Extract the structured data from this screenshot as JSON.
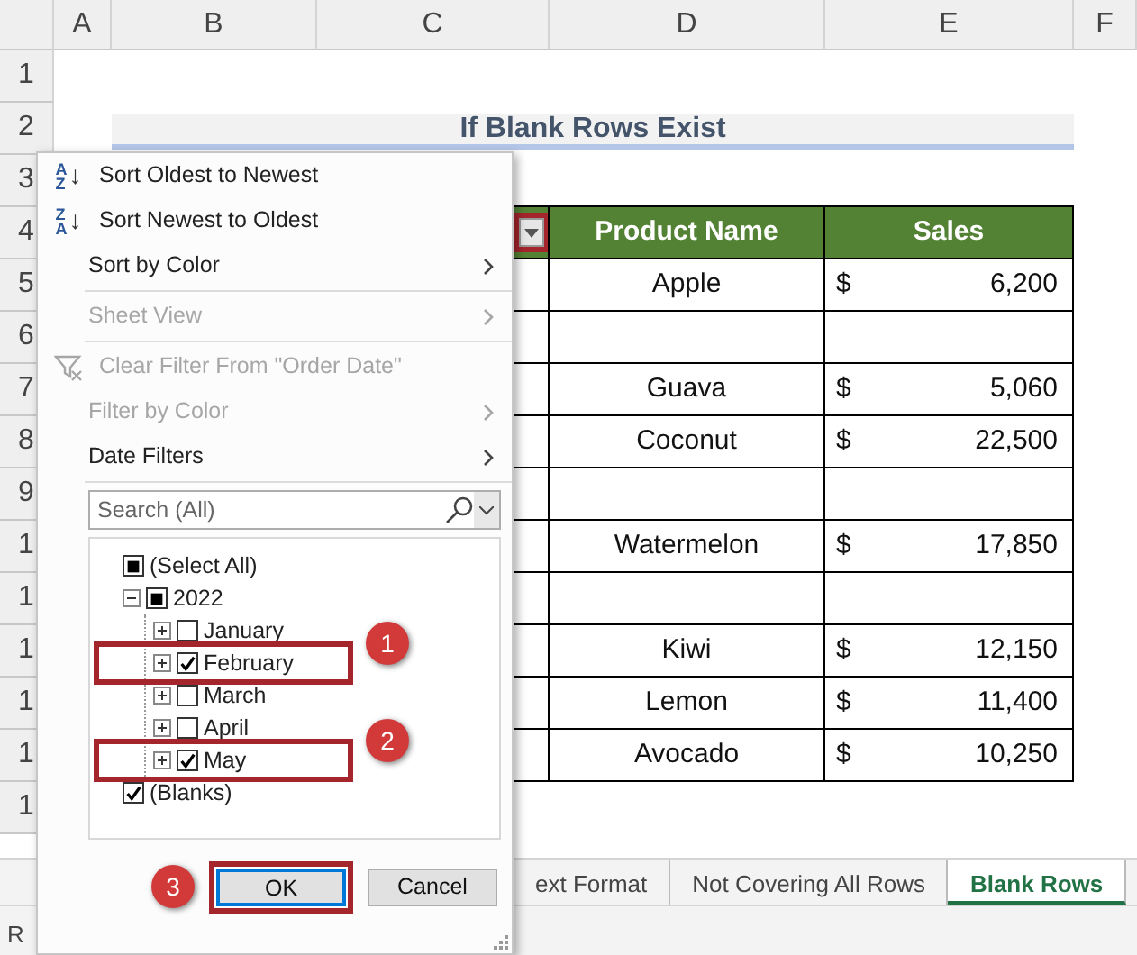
{
  "columns": [
    "A",
    "B",
    "C",
    "D",
    "E",
    "F"
  ],
  "rows": [
    "1",
    "2",
    "3",
    "4",
    "5",
    "6",
    "7",
    "8",
    "9",
    "1",
    "1",
    "1",
    "1",
    "1",
    "1"
  ],
  "title": "If Blank Rows Exist",
  "table": {
    "filter_button": {
      "highlighted": true
    },
    "columns": [
      "Product Name",
      "Sales"
    ],
    "rows": [
      {
        "product": "Apple",
        "currency": "$",
        "sales": "6,200"
      },
      {},
      {
        "product": "Guava",
        "currency": "$",
        "sales": "5,060"
      },
      {
        "product": "Coconut",
        "currency": "$",
        "sales": "22,500"
      },
      {},
      {
        "product": "Watermelon",
        "currency": "$",
        "sales": "17,850"
      },
      {},
      {
        "product": "Kiwi",
        "currency": "$",
        "sales": "12,150"
      },
      {
        "product": "Lemon",
        "currency": "$",
        "sales": "11,400"
      },
      {
        "product": "Avocado",
        "currency": "$",
        "sales": "10,250"
      }
    ]
  },
  "sheet_tabs": [
    {
      "label": "ext Format",
      "selected": false
    },
    {
      "label": "Not Covering All Rows",
      "selected": false
    },
    {
      "label": "Blank Rows",
      "selected": true
    }
  ],
  "status_bar": "R",
  "filter_menu": {
    "items": [
      {
        "kind": "sort",
        "label": "Sort Oldest to Newest",
        "icon": {
          "top": "A",
          "bottom": "Z",
          "arrow": "↓"
        },
        "disabled": false,
        "submenu": false
      },
      {
        "kind": "sort",
        "label": "Sort Newest to Oldest",
        "icon": {
          "top": "Z",
          "bottom": "A",
          "arrow": "↓"
        },
        "disabled": false,
        "submenu": false
      },
      {
        "kind": "item",
        "label": "Sort by Color",
        "disabled": false,
        "submenu": true
      },
      {
        "kind": "separator"
      },
      {
        "kind": "item",
        "label": "Sheet View",
        "disabled": true,
        "submenu": true
      },
      {
        "kind": "separator"
      },
      {
        "kind": "clear",
        "label": "Clear Filter From \"Order Date\"",
        "disabled": true,
        "submenu": false
      },
      {
        "kind": "item",
        "label": "Filter by Color",
        "disabled": true,
        "submenu": true
      },
      {
        "kind": "item",
        "label": "Date Filters",
        "disabled": false,
        "submenu": true
      },
      {
        "kind": "separator"
      }
    ],
    "search": {
      "placeholder": "Search (All)"
    },
    "tree": [
      {
        "label": "(Select All)",
        "checked": false,
        "mixed": true,
        "highlighted": false
      },
      {
        "label": "2022",
        "checked": false,
        "mixed": true,
        "expanded": true,
        "highlighted": false,
        "children": [
          {
            "label": "January",
            "checked": false,
            "mixed": false,
            "expanded": false,
            "highlighted": false
          },
          {
            "label": "February",
            "checked": true,
            "mixed": false,
            "expanded": false,
            "highlighted": true,
            "callout": "1"
          },
          {
            "label": "March",
            "checked": false,
            "mixed": false,
            "expanded": false,
            "highlighted": false
          },
          {
            "label": "April",
            "checked": false,
            "mixed": false,
            "expanded": false,
            "highlighted": false
          },
          {
            "label": "May",
            "checked": true,
            "mixed": false,
            "expanded": false,
            "highlighted": true,
            "callout": "2"
          }
        ]
      },
      {
        "label": "(Blanks)",
        "checked": true,
        "mixed": false,
        "highlighted": false
      }
    ],
    "buttons": [
      {
        "label": "OK",
        "highlighted": true,
        "callout": "3"
      },
      {
        "label": "Cancel",
        "highlighted": false
      }
    ]
  }
}
